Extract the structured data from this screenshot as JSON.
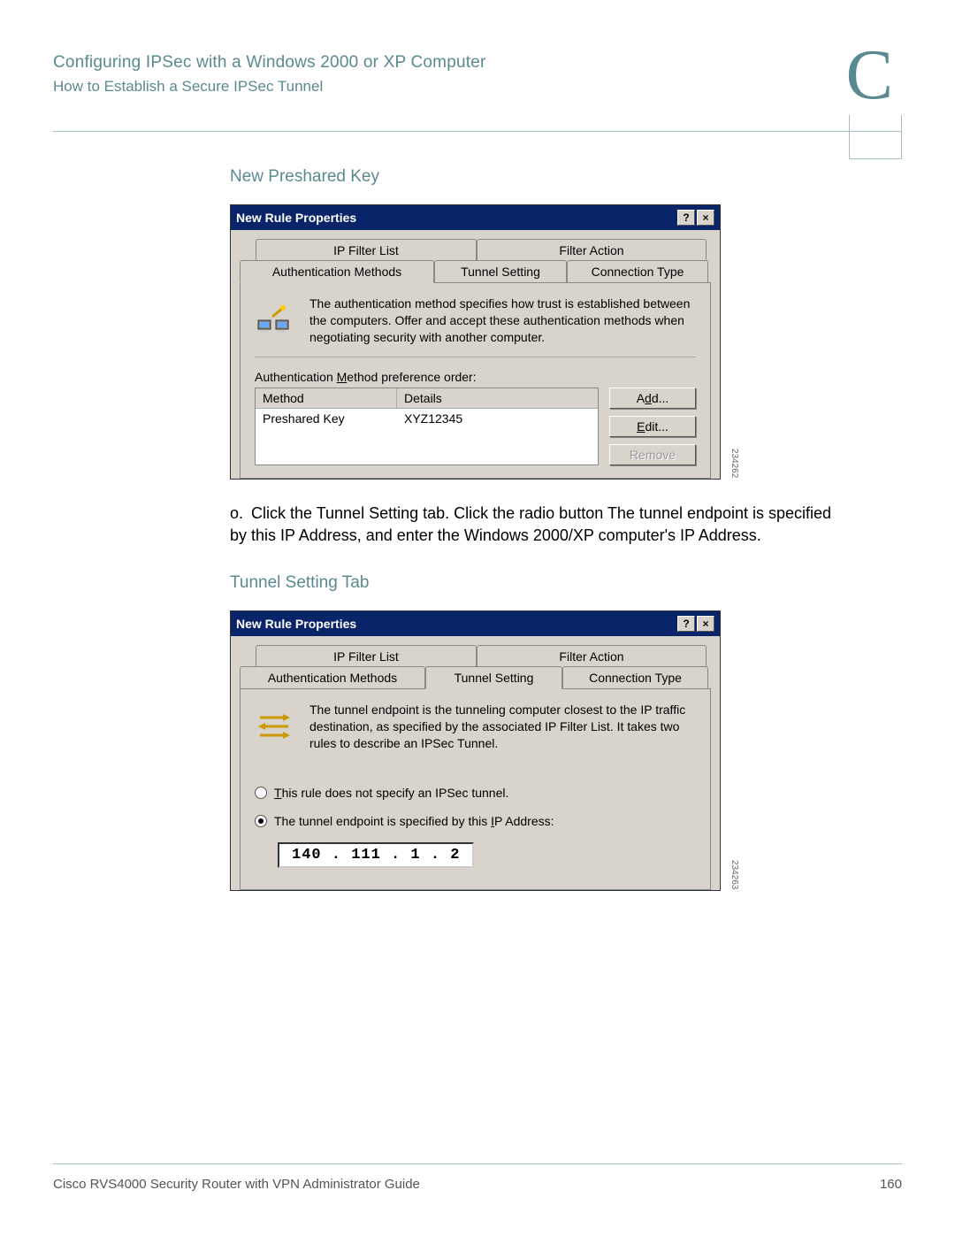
{
  "header": {
    "title": "Configuring IPSec with a Windows 2000 or XP Computer",
    "subtitle": "How to Establish a Secure IPSec Tunnel",
    "appendix_letter": "C"
  },
  "section1": {
    "heading": "New Preshared Key",
    "caption_id": "234262"
  },
  "dialog1": {
    "title": "New Rule Properties",
    "help_btn": "?",
    "close_btn": "×",
    "tabs": {
      "ip_filter_list": "IP Filter List",
      "filter_action": "Filter Action",
      "auth_methods": "Authentication Methods",
      "tunnel_setting": "Tunnel Setting",
      "connection_type": "Connection Type"
    },
    "info_text": "The authentication method specifies how trust is established between the computers. Offer and accept these authentication methods when negotiating security with another computer.",
    "pref_label_pre": "Authentication ",
    "pref_label_u": "M",
    "pref_label_post": "ethod preference order:",
    "columns": {
      "method": "Method",
      "details": "Details"
    },
    "row": {
      "method": "Preshared Key",
      "details": "XYZ12345"
    },
    "buttons": {
      "add_pre": "A",
      "add_u": "d",
      "add_post": "d...",
      "edit_u": "E",
      "edit_post": "dit...",
      "remove": "Remove"
    }
  },
  "step_o": {
    "marker": "o.",
    "text": "Click the Tunnel Setting tab. Click the radio button The tunnel endpoint is specified by this IP Address, and enter the Windows 2000/XP computer's IP Address."
  },
  "section2": {
    "heading": "Tunnel Setting Tab",
    "caption_id": "234263"
  },
  "dialog2": {
    "title": "New Rule Properties",
    "info_text": "The tunnel endpoint is the tunneling computer closest to the IP traffic destination, as specified by the associated IP Filter List. It takes two rules to describe an IPSec Tunnel.",
    "radio1_u": "T",
    "radio1_post": "his rule does not specify an IPSec tunnel.",
    "radio2_pre": "The tunnel endpoint is specified by this ",
    "radio2_u": "I",
    "radio2_post": "P Address:",
    "ip_value": "140 . 111 .  1   .  2"
  },
  "footer": {
    "guide": "Cisco RVS4000 Security Router with VPN Administrator Guide",
    "page": "160"
  }
}
